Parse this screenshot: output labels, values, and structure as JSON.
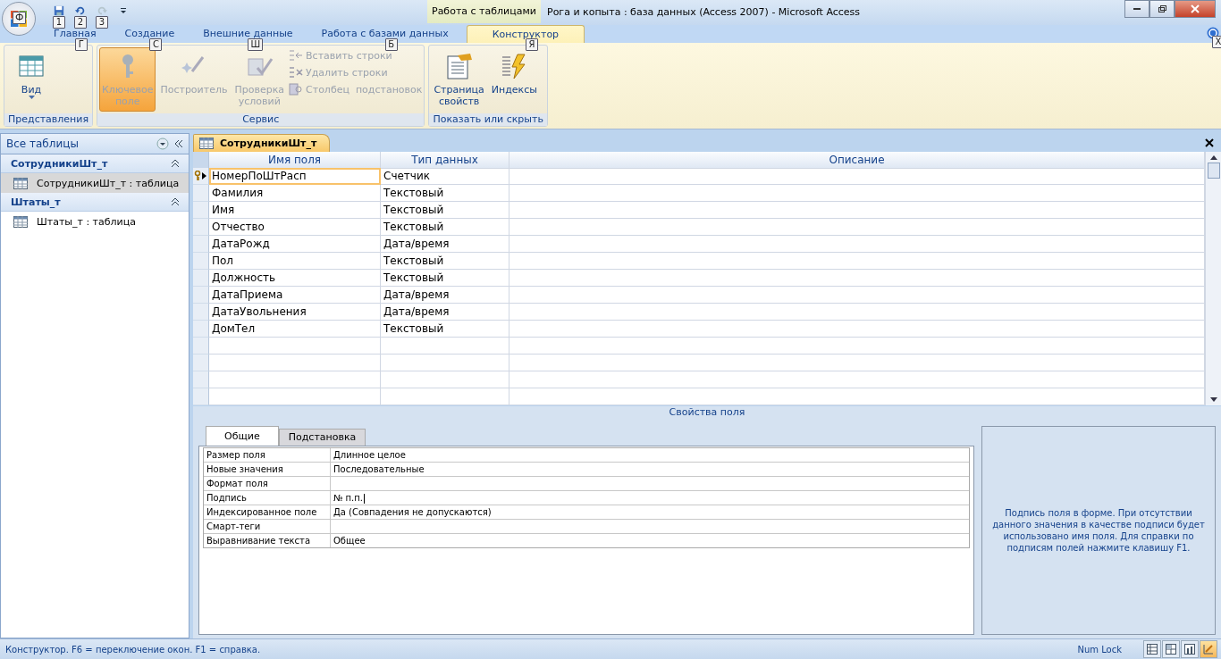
{
  "window": {
    "title": "Рога и копыта : база данных (Access 2007)  -  Microsoft Access",
    "contextual_tab": "Работа с таблицами"
  },
  "office_button": {
    "keytip": "Ф"
  },
  "quick_access": [
    {
      "kind": "save",
      "keytip": "1",
      "disabled": false
    },
    {
      "kind": "undo",
      "keytip": "2",
      "disabled": false
    },
    {
      "kind": "redo",
      "keytip": "3",
      "disabled": true
    }
  ],
  "ribbon_tabs": [
    {
      "label": "Главная",
      "keytip": "Г",
      "selected": false
    },
    {
      "label": "Создание",
      "keytip": "С",
      "selected": false
    },
    {
      "label": "Внешние данные",
      "keytip": "Ш",
      "selected": false
    },
    {
      "label": "Работа с базами данных",
      "keytip": "Б",
      "selected": false
    },
    {
      "label": "Конструктор",
      "keytip": "Я",
      "selected": true
    }
  ],
  "ribbon_groups": [
    {
      "label": "Представления",
      "items": [
        {
          "kind": "view",
          "label": "Вид",
          "disabled": false
        }
      ]
    },
    {
      "label": "Сервис",
      "items": [
        {
          "kind": "key",
          "label": "Ключевое\nполе",
          "disabled": true,
          "selected": true
        },
        {
          "kind": "builder",
          "label": "Построитель",
          "disabled": true
        },
        {
          "kind": "validation",
          "label": "Проверка\nусловий",
          "disabled": true
        },
        {
          "kind": "insert-rows",
          "label": "Вставить строки",
          "disabled": true
        },
        {
          "kind": "delete-rows",
          "label": "Удалить строки",
          "disabled": true
        },
        {
          "kind": "lookup",
          "label": "Столбец  подстановок",
          "disabled": true
        }
      ]
    },
    {
      "label": "Показать или скрыть",
      "items": [
        {
          "kind": "property-sheet",
          "label": "Страница\nсвойств",
          "disabled": false
        },
        {
          "kind": "indexes",
          "label": "Индексы",
          "disabled": false
        }
      ]
    }
  ],
  "help_tooltip": "Х",
  "nav_pane": {
    "title": "Все таблицы",
    "groups": [
      {
        "title": "СотрудникиШт_т",
        "expanded": true,
        "items": [
          {
            "label": "СотрудникиШт_т : таблица",
            "selected": true
          }
        ]
      },
      {
        "title": "Штаты_т",
        "expanded": true,
        "items": [
          {
            "label": "Штаты_т : таблица",
            "selected": false
          }
        ]
      }
    ]
  },
  "document_tab": {
    "label": "СотрудникиШт_т"
  },
  "design_grid": {
    "columns": [
      "Имя поля",
      "Тип данных",
      "Описание"
    ],
    "rows": [
      {
        "name": "НомерПоШтРасп",
        "type": "Счетчик",
        "primary_key": true,
        "current": true
      },
      {
        "name": "Фамилия",
        "type": "Текстовый",
        "primary_key": false,
        "current": false
      },
      {
        "name": "Имя",
        "type": "Текстовый",
        "primary_key": false,
        "current": false
      },
      {
        "name": "Отчество",
        "type": "Текстовый",
        "primary_key": false,
        "current": false
      },
      {
        "name": "ДатаРожд",
        "type": "Дата/время",
        "primary_key": false,
        "current": false
      },
      {
        "name": "Пол",
        "type": "Текстовый",
        "primary_key": false,
        "current": false
      },
      {
        "name": "Должность",
        "type": "Текстовый",
        "primary_key": false,
        "current": false
      },
      {
        "name": "ДатаПриема",
        "type": "Дата/время",
        "primary_key": false,
        "current": false
      },
      {
        "name": "ДатаУвольнения",
        "type": "Дата/время",
        "primary_key": false,
        "current": false
      },
      {
        "name": "ДомТел",
        "type": "Текстовый",
        "primary_key": false,
        "current": false
      }
    ]
  },
  "field_properties": {
    "title": "Свойства поля",
    "tabs": [
      {
        "label": "Общие",
        "selected": true
      },
      {
        "label": "Подстановка",
        "selected": false
      }
    ],
    "properties": [
      {
        "label": "Размер поля",
        "value": "Длинное целое",
        "editing": false
      },
      {
        "label": "Новые значения",
        "value": "Последовательные",
        "editing": false
      },
      {
        "label": "Формат поля",
        "editing": false
      },
      {
        "label": "Подпись",
        "value": "№ п.п.",
        "editing": true
      },
      {
        "label": "Индексированное поле",
        "value": "Да (Совпадения не допускаются)",
        "editing": false
      },
      {
        "label": "Смарт-теги",
        "editing": false
      },
      {
        "label": "Выравнивание текста",
        "value": "Общее",
        "editing": false
      }
    ],
    "help": "Подпись поля в форме.  При отсутствии данного значения в качестве подписи будет использовано имя поля.  Для справки по подписям полей нажмите клавишу F1."
  },
  "status_bar": {
    "text": "Конструктор.  F6 = переключение окон.  F1 = справка.",
    "indicator": "Num Lock",
    "views": [
      {
        "kind": "datasheet",
        "selected": false
      },
      {
        "kind": "pivot-table",
        "selected": false
      },
      {
        "kind": "pivot-chart",
        "selected": false
      },
      {
        "kind": "design",
        "selected": true
      }
    ]
  }
}
